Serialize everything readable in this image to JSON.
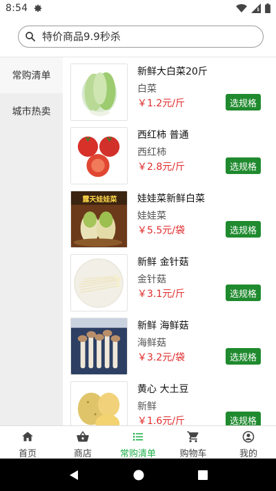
{
  "status_bar": {
    "time": "8:54"
  },
  "search": {
    "placeholder": "特价商品9.9秒杀"
  },
  "sidebar": {
    "items": [
      {
        "label": "常购清单",
        "active": true
      },
      {
        "label": "城市热卖",
        "active": false
      }
    ]
  },
  "products": [
    {
      "name": "新鲜大白菜20斤",
      "subtitle": "白菜",
      "price": "￥1.2元/斤",
      "button": "选规格",
      "image": "napa-cabbage"
    },
    {
      "name": "西红柿 普通",
      "subtitle": "西红柿",
      "price": "￥2.8元/斤",
      "button": "选规格",
      "image": "tomatoes"
    },
    {
      "name": "娃娃菜新鲜白菜",
      "subtitle": "娃娃菜",
      "price": "￥5.5元/袋",
      "button": "选规格",
      "image": "baby-cabbage",
      "image_text": "露天娃娃菜"
    },
    {
      "name": "新鲜 金针菇",
      "subtitle": "金针菇",
      "price": "￥3.1元/斤",
      "button": "选规格",
      "image": "enoki-mushroom"
    },
    {
      "name": "新鲜 海鲜菇",
      "subtitle": "海鲜菇",
      "price": "￥3.2元/袋",
      "button": "选规格",
      "image": "seafood-mushroom"
    },
    {
      "name": "黄心 大土豆",
      "subtitle": "新鲜",
      "price": "￥1.6元/斤",
      "button": "选规格",
      "image": "potatoes"
    }
  ],
  "bottom_nav": [
    {
      "label": "首页",
      "icon": "home-icon",
      "active": false
    },
    {
      "label": "商店",
      "icon": "shop-basket-icon",
      "active": false
    },
    {
      "label": "常购清单",
      "icon": "list-icon",
      "active": true
    },
    {
      "label": "购物车",
      "icon": "cart-icon",
      "active": false
    },
    {
      "label": "我的",
      "icon": "account-icon",
      "active": false
    }
  ],
  "colors": {
    "accent_green": "#1fb04a",
    "button_green": "#1f8a2e",
    "price_red": "#e02b2b",
    "sidebar_bg": "#eeeeee"
  }
}
